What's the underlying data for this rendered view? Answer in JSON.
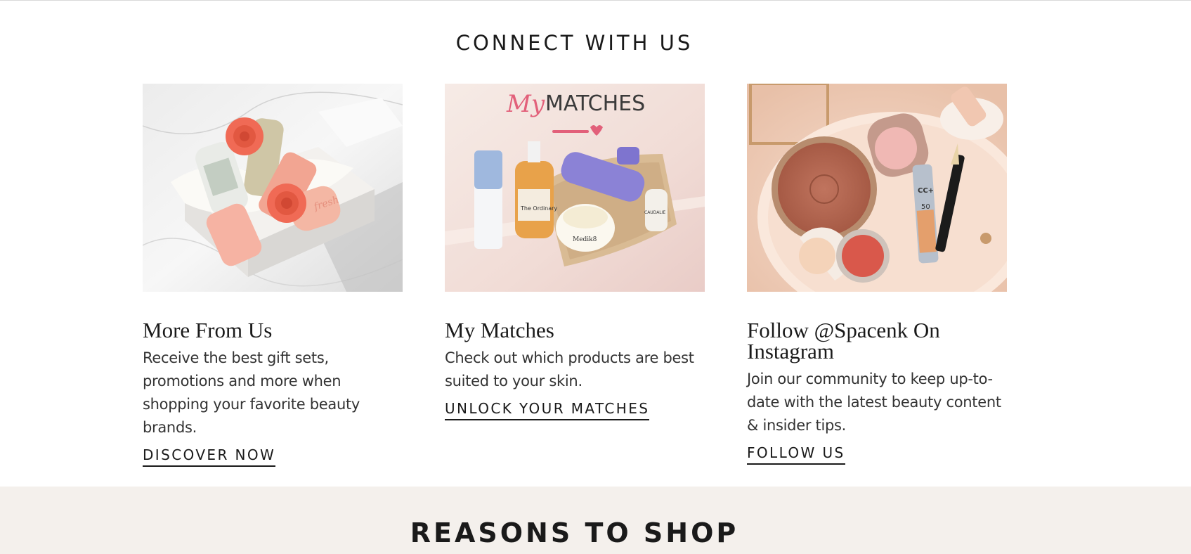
{
  "connect": {
    "title": "CONNECT WITH US",
    "cards": [
      {
        "title": "More From Us",
        "description": "Receive the best gift sets, promotions and more when shopping your favorite beauty brands.",
        "cta": "DISCOVER NOW",
        "image_text": "fresh"
      },
      {
        "title": "My Matches",
        "description": "Check out which products are best suited to your skin.",
        "cta": "UNLOCK YOUR MATCHES",
        "image_text_script": "My",
        "image_text_caps": "MATCHES",
        "image_labels": [
          "The Ordinary",
          "Medik8",
          "CAUDALIE"
        ]
      },
      {
        "title": "Follow @Spacenk On Instagram",
        "description": "Join our community to keep up-to-date with the latest beauty content & insider tips.",
        "cta": "FOLLOW US",
        "image_labels": [
          "CC+",
          "50"
        ]
      }
    ]
  },
  "reasons": {
    "title": "REASONS TO SHOP"
  },
  "colors": {
    "band": "#f4f0ec",
    "accent_pink": "#e2607a",
    "text": "#1a1a1a"
  }
}
